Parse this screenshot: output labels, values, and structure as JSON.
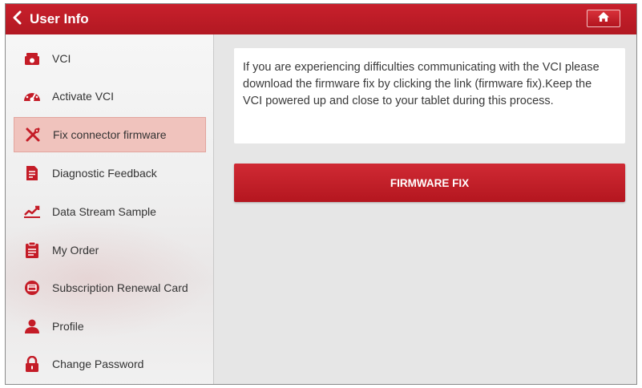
{
  "colors": {
    "accent": "#b8121d",
    "active_bg": "#f0c3bd"
  },
  "header": {
    "title": "User Info",
    "back_icon": "chevron-left-icon",
    "home_icon": "home-icon"
  },
  "sidebar": {
    "items": [
      {
        "label": "VCI",
        "icon": "vci-icon"
      },
      {
        "label": "Activate VCI",
        "icon": "activate-icon"
      },
      {
        "label": "Fix connector firmware",
        "icon": "tools-icon",
        "active": true
      },
      {
        "label": "Diagnostic Feedback",
        "icon": "feedback-icon"
      },
      {
        "label": "Data Stream Sample",
        "icon": "chart-icon"
      },
      {
        "label": "My Order",
        "icon": "order-icon"
      },
      {
        "label": "Subscription Renewal Card",
        "icon": "card-icon"
      },
      {
        "label": "Profile",
        "icon": "person-icon"
      },
      {
        "label": "Change Password",
        "icon": "lock-icon"
      }
    ]
  },
  "main": {
    "info_text": "If you are experiencing difficulties communicating with the VCI please download the firmware fix by clicking the link (firmware fix).Keep the VCI powered up and close to your tablet during this process.",
    "button_label": "FIRMWARE FIX"
  }
}
